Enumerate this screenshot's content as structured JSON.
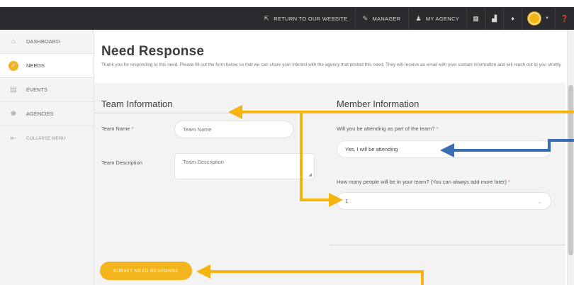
{
  "topnav": {
    "return_label": "RETURN TO OUR WEBSITE",
    "manager_label": "MANAGER",
    "agency_label": "MY AGENCY"
  },
  "sidebar": {
    "items": [
      {
        "label": "DASHBOARD",
        "icon": "home-icon"
      },
      {
        "label": "NEEDS",
        "icon": "check-circle-icon"
      },
      {
        "label": "EVENTS",
        "icon": "calendar-icon"
      },
      {
        "label": "AGENCIES",
        "icon": "agencies-icon"
      },
      {
        "label": "COLLAPSE MENU",
        "icon": "collapse-icon"
      }
    ]
  },
  "page": {
    "title": "Need Response",
    "description": "Thank you for responding to this need. Please fill out the form below so that we can share your interest with the agency that posted this need. They will receive an email with your contact information and will reach out to you shortly."
  },
  "team": {
    "title": "Team Information",
    "name_label": "Team Name",
    "name_placeholder": "Team Name",
    "desc_label": "Team Description",
    "desc_placeholder": "Team Description"
  },
  "member": {
    "title": "Member Information",
    "attending_label": "Will you be attending as part of the team?",
    "attending_value": "Yes, I will be attending",
    "people_label": "How many people will be in your team? (You can always add more later)",
    "people_value": "1"
  },
  "submit_label": "SUBMIT NEED RESPONSE",
  "colors": {
    "accent": "#f4b41d",
    "topbar": "#2a2b2e",
    "arrow_yellow": "#f5b50f",
    "arrow_blue": "#3b6db3"
  }
}
